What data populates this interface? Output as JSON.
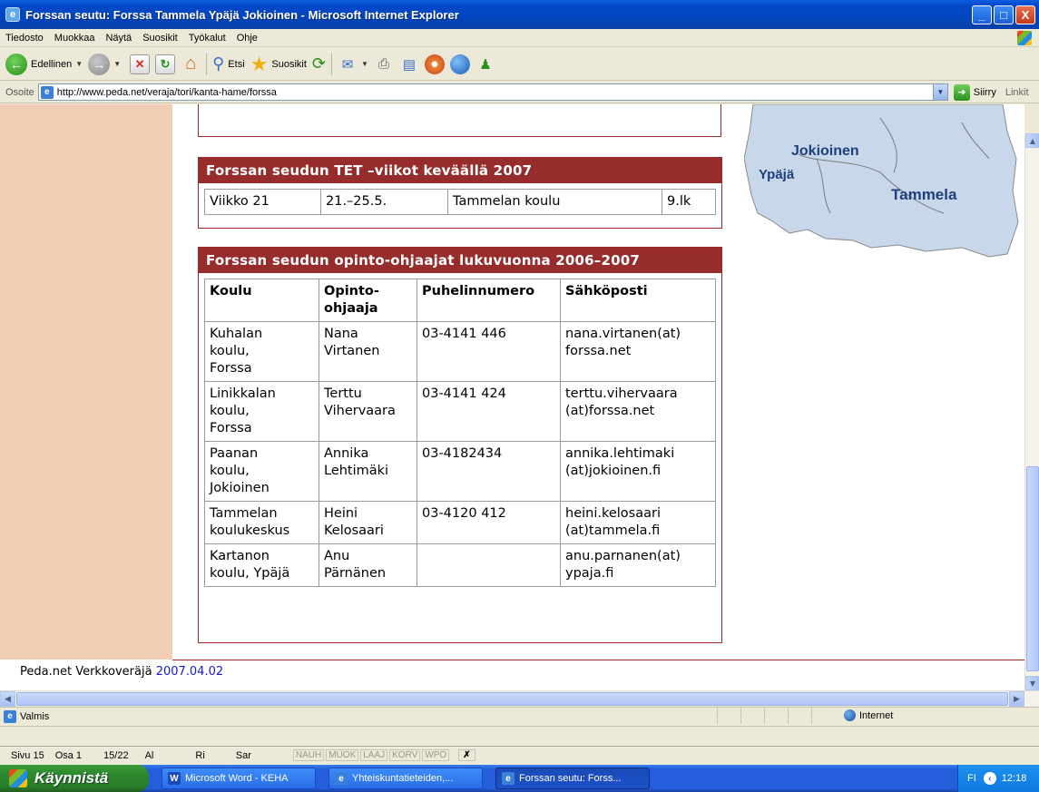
{
  "window": {
    "title": "Forssan seutu: Forssa Tammela Ypäjä Jokioinen - Microsoft Internet Explorer",
    "minimize": "_",
    "maximize": "□",
    "close": "X"
  },
  "menu": {
    "items": [
      "Tiedosto",
      "Muokkaa",
      "Näytä",
      "Suosikit",
      "Työkalut",
      "Ohje"
    ]
  },
  "toolbar": {
    "back_label": "Edellinen",
    "search_label": "Etsi",
    "favorites_label": "Suosikit",
    "icons": [
      "back-icon",
      "forward-icon",
      "stop-icon",
      "refresh-icon",
      "home-icon",
      "search-icon",
      "favorites-icon",
      "history-icon",
      "mail-icon",
      "print-icon",
      "edit-icon",
      "messenger-icon",
      "globe-icon",
      "people-icon"
    ]
  },
  "address": {
    "label": "Osoite",
    "url": "http://www.peda.net/veraja/tori/kanta-hame/forssa",
    "go_label": "Siirry",
    "links_label": "Linkit"
  },
  "map": {
    "labels": [
      "Jokioinen",
      "Ypäjä",
      "Tammela"
    ]
  },
  "tet_table": {
    "title": "Forssan seudun TET –viikot keväällä 2007",
    "row": [
      "Viikko 21",
      "21.–25.5.",
      "Tammelan koulu",
      "9.lk"
    ]
  },
  "counselor_table": {
    "title": "Forssan seudun opinto-ohjaajat lukuvuonna 2006–2007",
    "headers": [
      "Koulu",
      "Opinto-\nohjaaja",
      "Puhelinnumero",
      "Sähköposti"
    ],
    "rows": [
      [
        "Kuhalan\nkoulu,\nForssa",
        "Nana\nVirtanen",
        "03-4141 446",
        "nana.virtanen(at)\nforssa.net"
      ],
      [
        "Linikkalan\nkoulu,\nForssa",
        "Terttu\nVihervaara",
        "03-4141 424",
        "terttu.vihervaara\n(at)forssa.net"
      ],
      [
        "Paanan\nkoulu,\nJokioinen",
        "Annika\nLehtimäki",
        "03-4182434",
        "annika.lehtimaki\n(at)jokioinen.fi"
      ],
      [
        "Tammelan\nkoulukeskus",
        "Heini\nKelosaari",
        "03-4120 412",
        "heini.kelosaari\n(at)tammela.fi"
      ],
      [
        "Kartanon\nkoulu, Ypäjä",
        "Anu\nPärnänen",
        "",
        "anu.parnanen(at)\nypaja.fi"
      ]
    ]
  },
  "footer": {
    "text": "Peda.net Verkkoveräjä ",
    "link": "2007.04.02"
  },
  "status": {
    "text": "Valmis",
    "zone": "Internet"
  },
  "word_status": {
    "page": "Sivu 15",
    "section": "Osa 1",
    "pages": "15/22",
    "at": "Al",
    "line": "Ri",
    "col": "Sar",
    "modes": [
      "NAUH",
      "MUOK",
      "LAAJ",
      "KORV",
      "WPO"
    ]
  },
  "taskbar": {
    "start_label": "Käynnistä",
    "tasks": [
      {
        "label": "Microsoft Word - KEHA",
        "icon": "word-icon",
        "active": false
      },
      {
        "label": "Yhteiskuntatieteiden,...",
        "icon": "ie-icon",
        "active": false
      },
      {
        "label": "Forssan seutu: Forss...",
        "icon": "ie-icon",
        "active": true
      }
    ],
    "lang": "FI",
    "clock": "12:18"
  },
  "colors": {
    "header_red": "#962c2c",
    "sidebar_peach": "#f0cdb4",
    "map_blue": "#c9d7ea",
    "link_blue": "#1a1ac8"
  }
}
